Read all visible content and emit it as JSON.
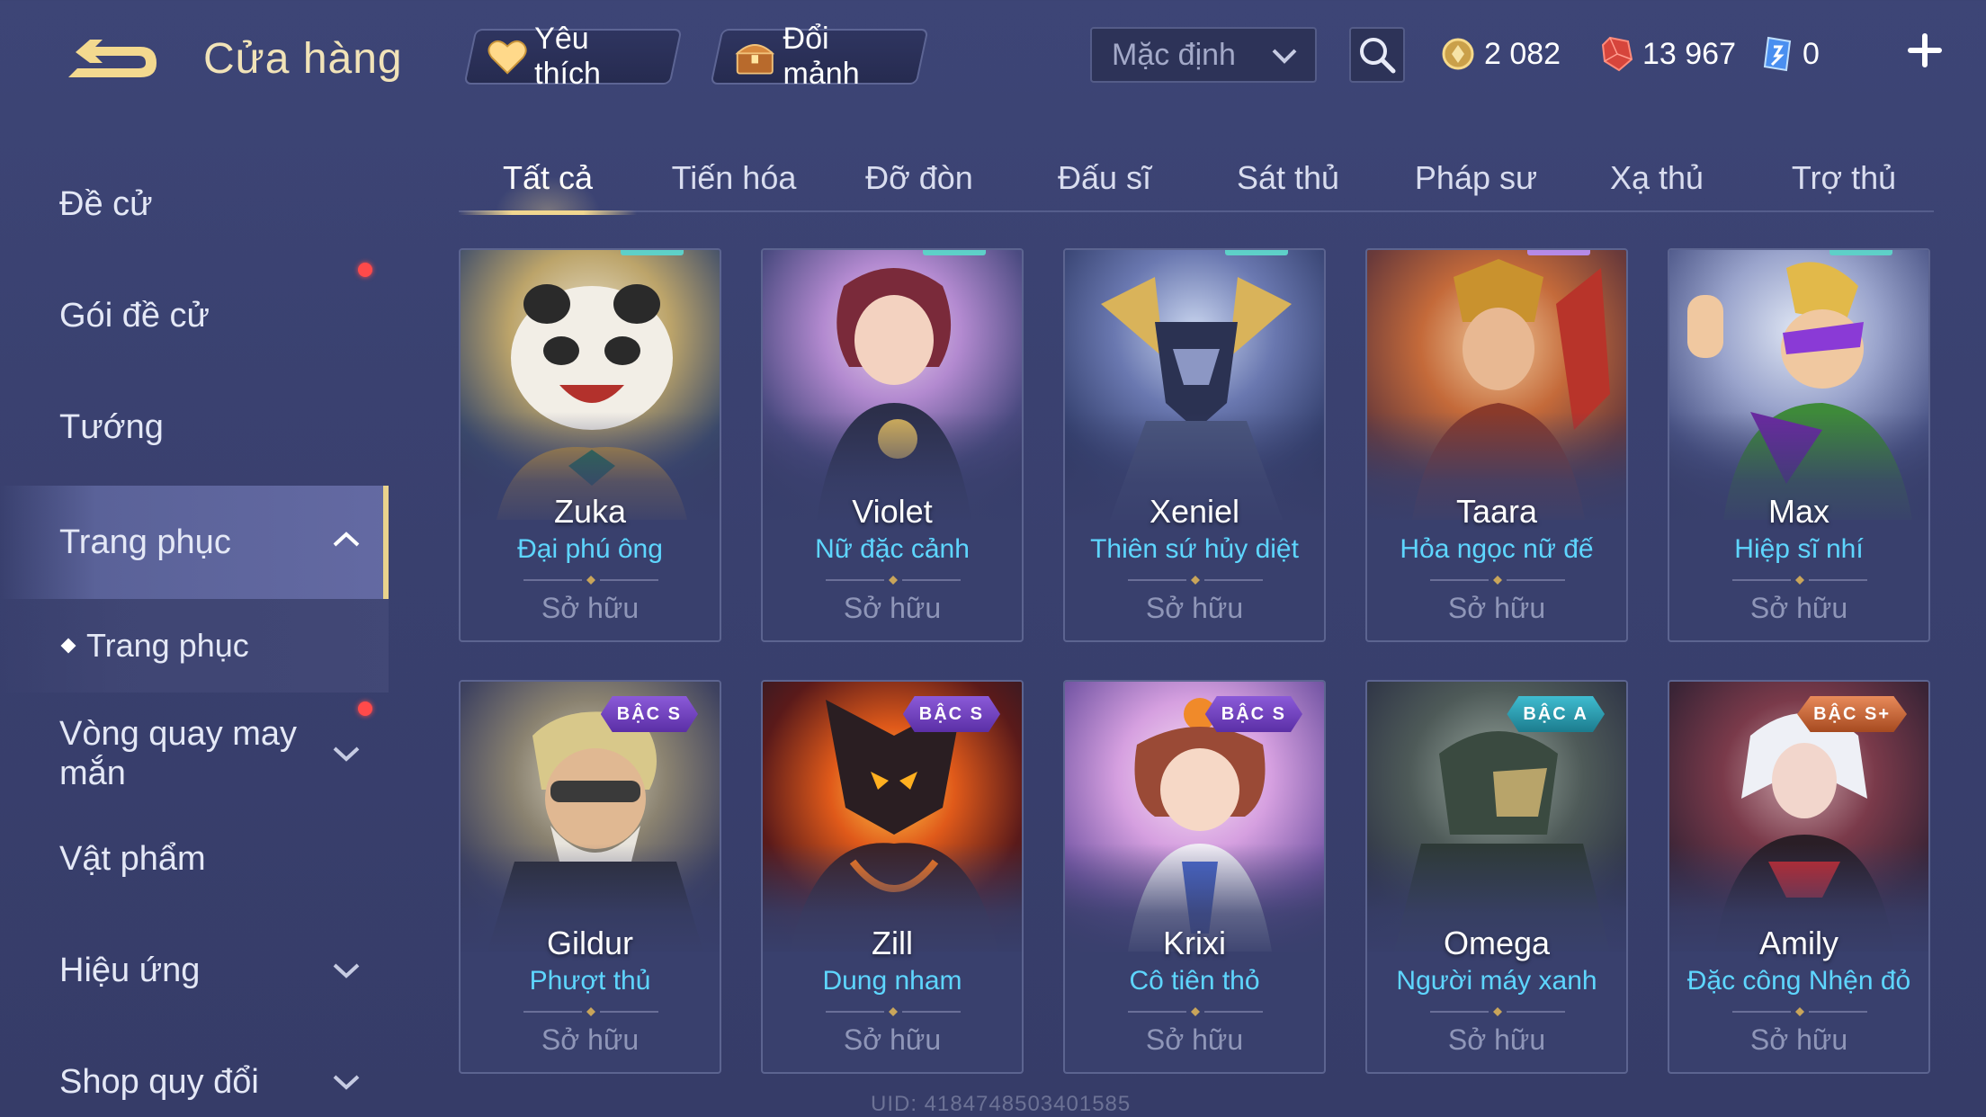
{
  "header": {
    "title": "Cửa hàng",
    "favorites_label": "Yêu thích",
    "exchange_label": "Đổi mảnh",
    "sort_value": "Mặc định",
    "gold": "2 082",
    "ruby": "13 967",
    "voucher": "0"
  },
  "sidebar": {
    "items": [
      {
        "label": "Đề cử"
      },
      {
        "label": "Gói đề cử"
      },
      {
        "label": "Tướng"
      },
      {
        "label": "Trang phục"
      },
      {
        "label": "Trang phục"
      },
      {
        "label": "Vòng quay may mắn"
      },
      {
        "label": "Vật phẩm"
      },
      {
        "label": "Hiệu ứng"
      },
      {
        "label": "Shop quy đổi"
      }
    ]
  },
  "tabs": [
    {
      "label": "Tất cả"
    },
    {
      "label": "Tiến hóa"
    },
    {
      "label": "Đỡ đòn"
    },
    {
      "label": "Đấu sĩ"
    },
    {
      "label": "Sát thủ"
    },
    {
      "label": "Pháp sư"
    },
    {
      "label": "Xạ thủ"
    },
    {
      "label": "Trợ thủ"
    }
  ],
  "cards": [
    {
      "hero": "Zuka",
      "skin": "Đại phú ông",
      "status": "Sở hữu",
      "tier": ""
    },
    {
      "hero": "Violet",
      "skin": "Nữ đặc cảnh",
      "status": "Sở hữu",
      "tier": ""
    },
    {
      "hero": "Xeniel",
      "skin": "Thiên sứ hủy diệt",
      "status": "Sở hữu",
      "tier": ""
    },
    {
      "hero": "Taara",
      "skin": "Hỏa ngọc nữ đế",
      "status": "Sở hữu",
      "tier": ""
    },
    {
      "hero": "Max",
      "skin": "Hiệp sĩ nhí",
      "status": "Sở hữu",
      "tier": ""
    },
    {
      "hero": "Gildur",
      "skin": "Phượt thủ",
      "status": "Sở hữu",
      "tier": "BẬC S"
    },
    {
      "hero": "Zill",
      "skin": "Dung nham",
      "status": "Sở hữu",
      "tier": "BẬC S"
    },
    {
      "hero": "Krixi",
      "skin": "Cô tiên thỏ",
      "status": "Sở hữu",
      "tier": "BẬC S"
    },
    {
      "hero": "Omega",
      "skin": "Người máy xanh",
      "status": "Sở hữu",
      "tier": "BẬC A"
    },
    {
      "hero": "Amily",
      "skin": "Đặc công Nhện đỏ",
      "status": "Sở hữu",
      "tier": "BẬC S+"
    }
  ],
  "footer": {
    "uid": "UID: 4184748503401585"
  },
  "colors": {
    "accent_gold": "#f0d690",
    "skin_name": "#5ed6ff",
    "notification": "#ff4a4a"
  },
  "icons": [
    "back-arrow-icon",
    "heart-icon",
    "chest-icon",
    "chevron-down-icon",
    "search-icon",
    "gold-coin-icon",
    "ruby-gem-icon",
    "voucher-icon",
    "plus-icon",
    "chevron-up-icon"
  ]
}
